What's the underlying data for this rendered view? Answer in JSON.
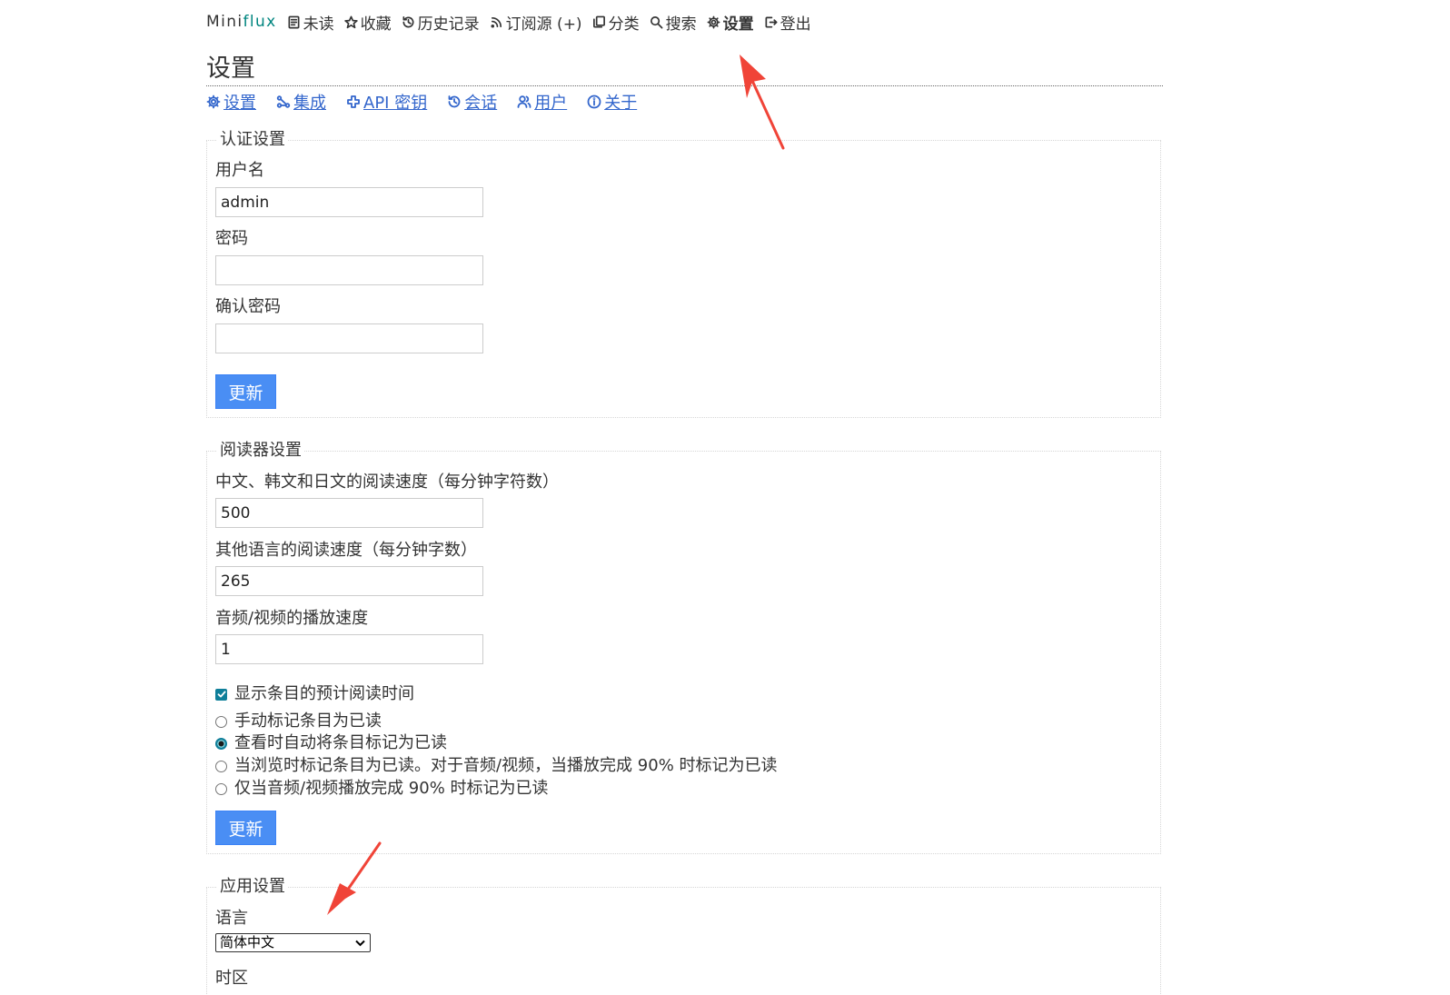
{
  "nav": {
    "logo_prefix": "Mini",
    "logo_suffix": "flux",
    "items": [
      {
        "label": "未读",
        "icon": "unread-icon"
      },
      {
        "label": "收藏",
        "icon": "star-icon"
      },
      {
        "label": "历史记录",
        "icon": "history-icon"
      },
      {
        "label": "订阅源 (+)",
        "icon": "rss-icon"
      },
      {
        "label": "分类",
        "icon": "categories-icon"
      },
      {
        "label": "搜索",
        "icon": "search-icon"
      },
      {
        "label": "设置",
        "icon": "gear-icon",
        "active": true
      },
      {
        "label": "登出",
        "icon": "logout-icon"
      }
    ]
  },
  "page": {
    "title": "设置"
  },
  "subtabs": [
    {
      "label": "设置",
      "icon": "gear-icon"
    },
    {
      "label": "集成",
      "icon": "integration-icon"
    },
    {
      "label": "API 密钥",
      "icon": "api-key-icon"
    },
    {
      "label": "会话",
      "icon": "session-icon"
    },
    {
      "label": "用户",
      "icon": "users-icon"
    },
    {
      "label": "关于",
      "icon": "info-icon"
    }
  ],
  "auth": {
    "legend": "认证设置",
    "username_label": "用户名",
    "username_value": "admin",
    "password_label": "密码",
    "password_value": "",
    "confirm_label": "确认密码",
    "confirm_value": "",
    "update_label": "更新"
  },
  "reader": {
    "legend": "阅读器设置",
    "cjk_speed_label": "中文、韩文和日文的阅读速度（每分钟字符数）",
    "cjk_speed_value": "500",
    "other_speed_label": "其他语言的阅读速度（每分钟字数）",
    "other_speed_value": "265",
    "media_speed_label": "音频/视频的播放速度",
    "media_speed_value": "1",
    "show_reading_time_label": "显示条目的预计阅读时间",
    "show_reading_time_checked": true,
    "mark_read_options": [
      {
        "label": "手动标记条目为已读",
        "selected": false
      },
      {
        "label": "查看时自动将条目标记为已读",
        "selected": true
      },
      {
        "label": "当浏览时标记条目为已读。对于音频/视频，当播放完成 90% 时标记为已读",
        "selected": false
      },
      {
        "label": "仅当音频/视频播放完成 90% 时标记为已读",
        "selected": false
      }
    ],
    "update_label": "更新"
  },
  "app": {
    "legend": "应用设置",
    "language_label": "语言",
    "language_value": "简体中文",
    "timezone_label": "时区"
  },
  "colors": {
    "accent_link": "#3366cc",
    "button": "#4a8ef4",
    "logo_flux": "#00857f",
    "annotation_arrow": "#f04438"
  }
}
